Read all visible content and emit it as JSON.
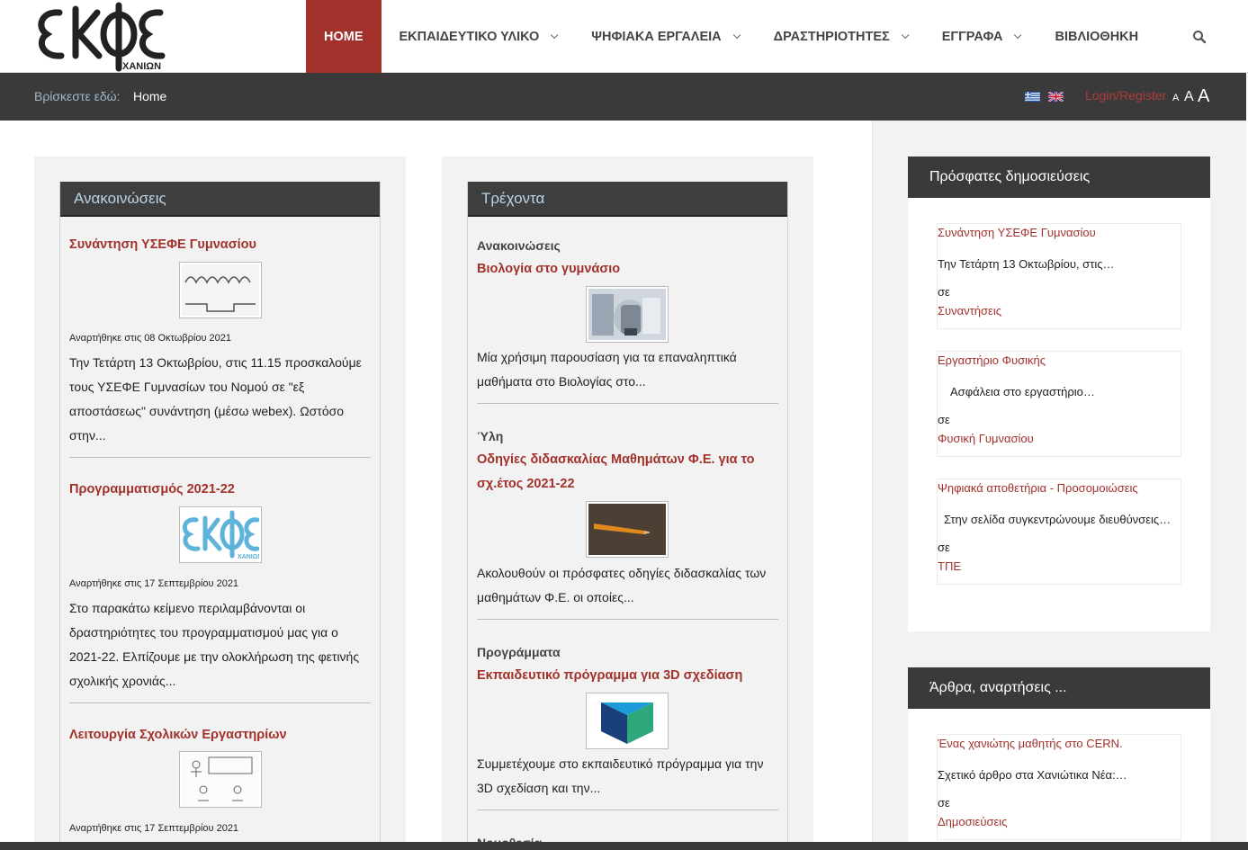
{
  "header": {
    "logo_text": "ΕΚΦΕ",
    "logo_sub": "ΧΑΝΙΩΝ",
    "nav": [
      {
        "label": "HOME",
        "active": true,
        "dropdown": false
      },
      {
        "label": "ΕΚΠΑΙΔΕΥΤΙΚΟ ΥΛΙΚΟ",
        "active": false,
        "dropdown": true
      },
      {
        "label": "ΨΗΦΙΑΚΑ ΕΡΓΑΛΕΙΑ",
        "active": false,
        "dropdown": true
      },
      {
        "label": "ΔΡΑΣΤΗΡΙΟΤΗΤΕΣ",
        "active": false,
        "dropdown": true
      },
      {
        "label": "ΕΓΓΡΑΦΑ",
        "active": false,
        "dropdown": true
      },
      {
        "label": "ΒΙΒΛΙΟΘΗΚΗ",
        "active": false,
        "dropdown": false
      }
    ],
    "search_icon": "search-icon"
  },
  "breadcrumb": {
    "label": "Βρίσκεστε εδώ:",
    "current": "Home",
    "login": "Login/Register",
    "font_sizes": [
      "A",
      "A",
      "A"
    ]
  },
  "announcements": {
    "heading": "Ανακοινώσεις",
    "items": [
      {
        "title": "Συνάντηση ΥΣΕΦΕ Γυμνασίου",
        "date": "Αναρτήθηκε στις 08 Οκτωβρίου 2021",
        "excerpt_lines": [
          "Την Τετάρτη 13 Οκτωβρίου, στις 11.15 προσκαλούμε",
          "τους ΥΣΕΦΕ Γυμνασίων του Νομού σε \"εξ",
          "αποστάσεως\" συνάντηση (μέσω webex). Ωστόσο",
          "στην..."
        ]
      },
      {
        "title": "Προγραμματισμός 2021-22",
        "date": "Αναρτήθηκε στις 17 Σεπτεμβρίου 2021",
        "excerpt_lines": [
          "Στο παρακάτω κείμενο περιλαμβάνονται οι",
          "δραστηριότητες του προγραμματισμού μας για ο",
          "2021-22. Ελπίζουμε με την ολοκλήρωση της φετινής",
          "σχολικής χρονιάς..."
        ]
      },
      {
        "title": "Λειτουργία Σχολικών Εργαστηρίων",
        "date": "Αναρτήθηκε στις 17 Σεπτεμβρίου 2021",
        "excerpt_lines": []
      }
    ]
  },
  "current": {
    "heading": "Τρέχοντα",
    "items": [
      {
        "category": "Ανακοινώσεις",
        "title_lines": [
          "Βιολογία στο γυμνάσιο"
        ],
        "excerpt_lines": [
          "Μία χρήσιμη παρουσίαση για τα επαναληπτικά",
          "μαθήματα στο Βιολογίας στο..."
        ]
      },
      {
        "category": "Ύλη",
        "title_lines": [
          "Οδηγίες διδασκαλίας Μαθημάτων Φ.Ε. για το",
          "σχ.έτος 2021-22"
        ],
        "excerpt_lines": [
          "Ακολουθούν οι πρόσφατες οδηγίες διδασκαλίας των",
          "μαθημάτων Φ.Ε. οι οποίες..."
        ]
      },
      {
        "category": "Προγράμματα",
        "title_lines": [
          "Εκπαιδευτικό πρόγραμμα για 3D σχεδίαση"
        ],
        "excerpt_lines": [
          "Συμμετέχουμε στο εκπαιδευτικό πρόγραμμα για την",
          "3D σχεδίαση και την..."
        ]
      },
      {
        "category": "Νομοθεσία",
        "title_lines": [],
        "excerpt_lines": []
      }
    ]
  },
  "recent": {
    "heading": "Πρόσφατες δημοσιεύσεις",
    "in_label": "σε",
    "posts": [
      {
        "title": "Συνάντηση ΥΣΕΦΕ Γυμνασίου",
        "excerpt": "Την Τετάρτη 13 Οκτωβρίου, στις…",
        "category": "Συναντήσεις"
      },
      {
        "title": "Εργαστήριο Φυσικής",
        "excerpt": "Ασφάλεια στο εργαστήριο…",
        "category": "Φυσική Γυμνασίου"
      },
      {
        "title": "Ψηφιακά αποθετήρια - Προσομοιώσεις",
        "excerpt": "Στην σελίδα συγκεντρώνουμε διευθύνσεις…",
        "category": "ΤΠΕ"
      }
    ]
  },
  "articles": {
    "heading": "Άρθρα, αναρτήσεις ...",
    "in_label": "σε",
    "posts": [
      {
        "title": "Ένας χανιώτης μαθητής στο CERN.",
        "excerpt": "Σχετικό άρθρο στα Χανιώτικα Νέα:…",
        "category": "Δημοσιεύσεις"
      }
    ]
  },
  "colors": {
    "accent": "#a3312b",
    "bar": "#3a3a3a",
    "panel": "#f2f2f2"
  }
}
